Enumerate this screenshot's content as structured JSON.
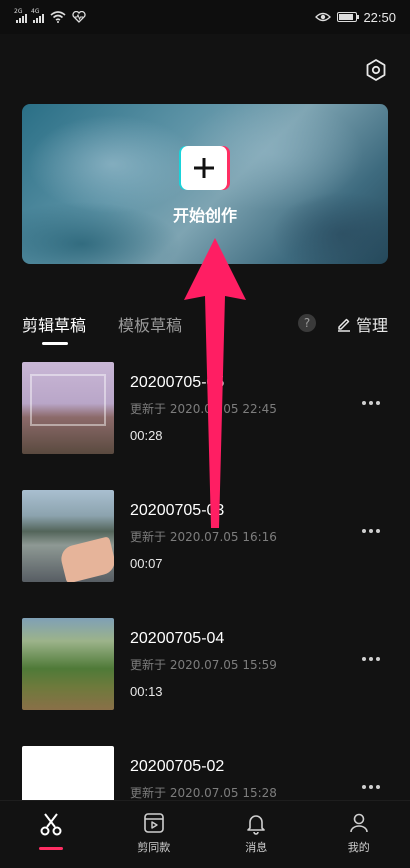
{
  "status_bar": {
    "time": "22:50",
    "network_1": "2G",
    "network_2": "4G"
  },
  "hero": {
    "title": "开始创作"
  },
  "tabs": [
    {
      "label": "剪辑草稿",
      "active": true
    },
    {
      "label": "模板草稿",
      "active": false
    }
  ],
  "help_icon": "?",
  "manage_label": "管理",
  "drafts": [
    {
      "title": "20200705-05",
      "updated": "更新于 2020.07.05 22:45",
      "duration": "00:28"
    },
    {
      "title": "20200705-03",
      "updated": "更新于 2020.07.05 16:16",
      "duration": "00:07"
    },
    {
      "title": "20200705-04",
      "updated": "更新于 2020.07.05 15:59",
      "duration": "00:13"
    },
    {
      "title": "20200705-02",
      "updated": "更新于 2020.07.05 15:28",
      "duration": ""
    }
  ],
  "bottom_nav": [
    {
      "label": "",
      "icon": "scissors-icon",
      "active": true
    },
    {
      "label": "剪同款",
      "icon": "clapper-icon",
      "active": false
    },
    {
      "label": "消息",
      "icon": "bell-icon",
      "active": false
    },
    {
      "label": "我的",
      "icon": "profile-icon",
      "active": false
    }
  ],
  "colors": {
    "accent": "#ff2e63",
    "background": "#121212"
  }
}
